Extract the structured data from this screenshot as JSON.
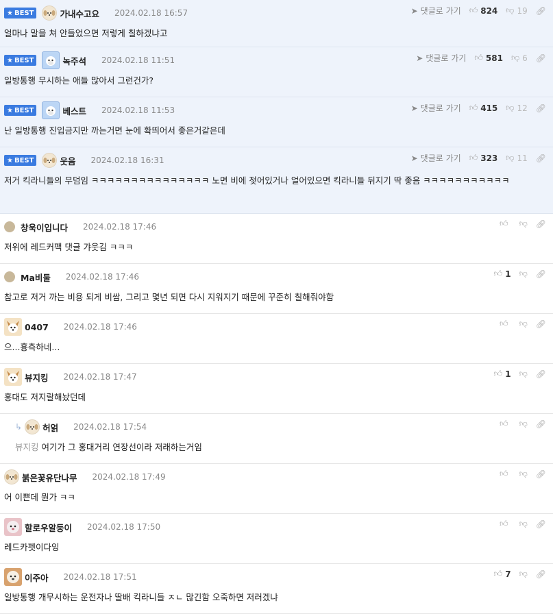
{
  "best_label": "BEST",
  "reply_link_label": "댓글로 가기",
  "comments": [
    {
      "type": "best",
      "nick": "가내수고요",
      "date": "2024.02.18 16:57",
      "text": "얼마나 말을 쳐 안들었으면 저렇게 칠하겠냐고",
      "up": "824",
      "down": "19",
      "avatar": "puppy"
    },
    {
      "type": "best",
      "nick": "녹주석",
      "date": "2024.02.18 11:51",
      "text": "일방통행 무시하는 애들 많아서 그런건가?",
      "up": "581",
      "down": "6",
      "avatar": "blue"
    },
    {
      "type": "best",
      "nick": "베스트",
      "date": "2024.02.18 11:53",
      "text": "난 일방통행 진입금지만 까는거면 눈에 확띄어서 좋은거같은데",
      "up": "415",
      "down": "12",
      "avatar": "blue"
    },
    {
      "type": "best",
      "nick": "웃음",
      "date": "2024.02.18 16:31",
      "text": "저거 킥라니들의 무덤임 ㅋㅋㅋㅋㅋㅋㅋㅋㅋㅋㅋㅋㅋㅋㅋ 노면 비에 젖어있거나 얼어있으면 킥라니들 뒤지기 딱 좋음 ㅋㅋㅋㅋㅋㅋㅋㅋㅋㅋㅋ",
      "up": "323",
      "down": "11",
      "avatar": "puppy"
    },
    {
      "type": "normal",
      "nick": "창욱이입니다",
      "date": "2024.02.18 17:46",
      "text": "저위에 레드커팩 댓글 갸웃김 ㅋㅋㅋ",
      "up": "",
      "down": "",
      "avatar": "dot"
    },
    {
      "type": "normal",
      "nick": "Ma비둘",
      "date": "2024.02.18 17:46",
      "text": "참고로 저거 까는 비용 되게 비쌈, 그리고 몇년 되면 다시 지워지기 때문에 꾸준히 칠해줘야함",
      "up": "1",
      "down": "",
      "avatar": "dot"
    },
    {
      "type": "normal",
      "nick": "0407",
      "date": "2024.02.18 17:46",
      "text": "으...흉측하네...",
      "up": "",
      "down": "",
      "avatar": "dog"
    },
    {
      "type": "normal",
      "nick": "뷰지킹",
      "date": "2024.02.18 17:47",
      "text": "홍대도 저지랄해놨던데",
      "up": "1",
      "down": "",
      "avatar": "dog"
    },
    {
      "type": "reply",
      "nick": "허얽",
      "date": "2024.02.18 17:54",
      "mention": "뷰지킹",
      "text": "여기가 그 홍대거리 연장선이라 저래하는거임",
      "up": "",
      "down": "",
      "avatar": "puppy"
    },
    {
      "type": "normal",
      "nick": "붉은꽃유단나무",
      "date": "2024.02.18 17:49",
      "text": "어 이쁜데 뭔가 ㅋㅋ",
      "up": "",
      "down": "",
      "avatar": "puppy"
    },
    {
      "type": "normal",
      "nick": "할로우알둥이",
      "date": "2024.02.18 17:50",
      "text": "레드카펫이다잉",
      "up": "",
      "down": "",
      "avatar": "pink"
    },
    {
      "type": "normal",
      "nick": "이주아",
      "date": "2024.02.18 17:51",
      "text": "일방통행 개무시하는 운전자나 딸배 킥라니들 ㅈㄴ 많긴함 오죽하면 저러겠냐",
      "up": "7",
      "down": "",
      "avatar": "brown"
    }
  ]
}
